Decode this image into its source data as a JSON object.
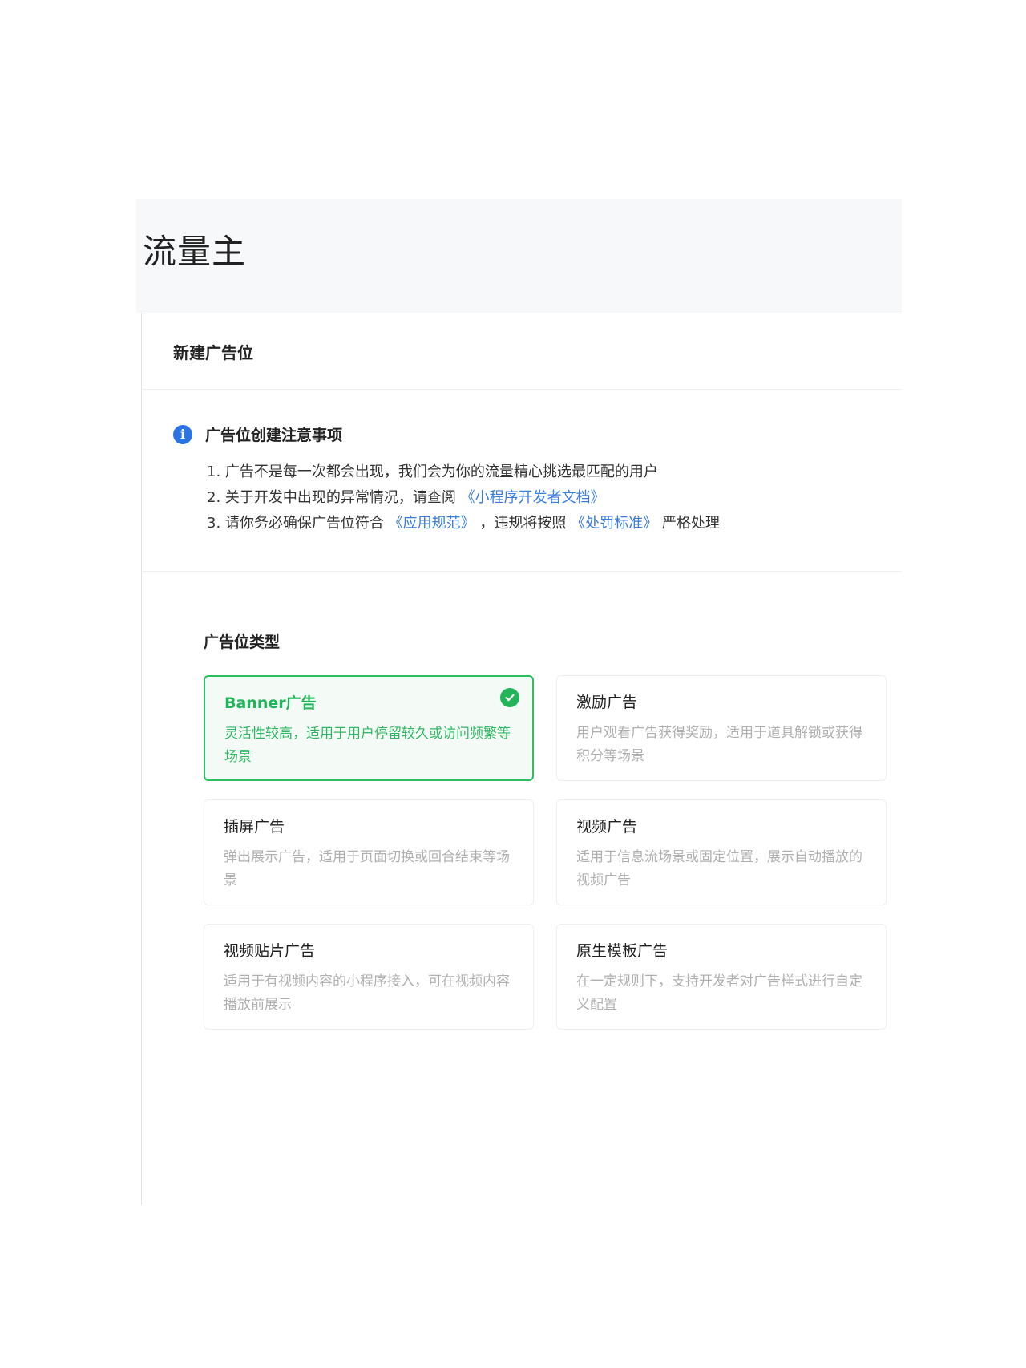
{
  "app": {
    "brand": "流量主"
  },
  "card": {
    "title": "新建广告位"
  },
  "notice": {
    "icon": "info-icon",
    "title": "广告位创建注意事项",
    "line1": "1. 广告不是每一次都会出现，我们会为你的流量精心挑选最匹配的用户",
    "line2_prefix": "2. 关于开发中出现的异常情况，请查阅",
    "line2_link": "《小程序开发者文档》",
    "line3_prefix": "3. 请你务必确保广告位符合",
    "line3_link1": "《应用规范》",
    "line3_mid": "，违规将按照",
    "line3_link2": "《处罚标准》",
    "line3_suffix": "严格处理"
  },
  "types": {
    "label": "广告位类型",
    "items": [
      {
        "name": "Banner广告",
        "desc": "灵活性较高，适用于用户停留较久或访问频繁等场景",
        "selected": true
      },
      {
        "name": "激励广告",
        "desc": "用户观看广告获得奖励，适用于道具解锁或获得积分等场景",
        "selected": false
      },
      {
        "name": "插屏广告",
        "desc": "弹出展示广告，适用于页面切换或回合结束等场景",
        "selected": false
      },
      {
        "name": "视频广告",
        "desc": "适用于信息流场景或固定位置，展示自动播放的视频广告",
        "selected": false
      },
      {
        "name": "视频贴片广告",
        "desc": "适用于有视频内容的小程序接入，可在视频内容播放前展示",
        "selected": false
      },
      {
        "name": "原生模板广告",
        "desc": "在一定规则下，支持开发者对广告样式进行自定义配置",
        "selected": false
      }
    ]
  },
  "colors": {
    "accent": "#23b45a",
    "link": "#3a7ce0",
    "info": "#2b74e2"
  }
}
